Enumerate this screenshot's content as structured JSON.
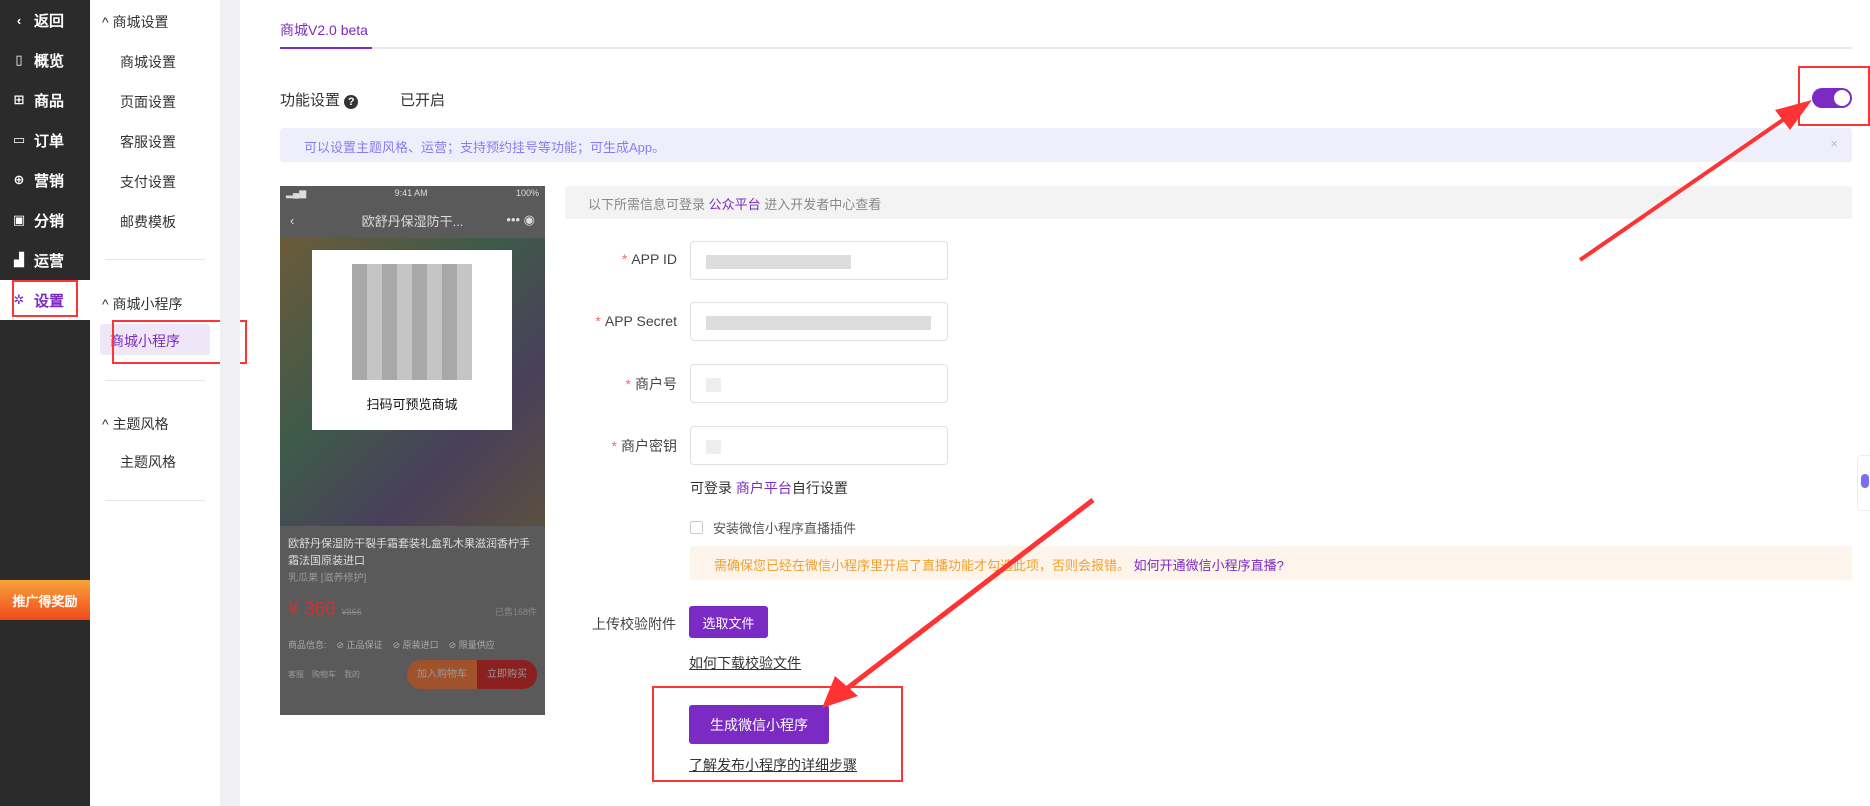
{
  "nav": {
    "items": [
      {
        "label": "返回",
        "icon": "chevron-left-icon"
      },
      {
        "label": "概览",
        "icon": "book-icon"
      },
      {
        "label": "商品",
        "icon": "gift-icon"
      },
      {
        "label": "订单",
        "icon": "folder-icon"
      },
      {
        "label": "营销",
        "icon": "target-icon"
      },
      {
        "label": "分销",
        "icon": "wallet-icon"
      },
      {
        "label": "运营",
        "icon": "bar-chart-icon"
      },
      {
        "label": "设置",
        "icon": "gear-icon"
      }
    ],
    "active": "设置",
    "promo": "推广得奖励"
  },
  "submenu": {
    "groups": [
      {
        "title": "商城设置",
        "items": [
          "商城设置",
          "页面设置",
          "客服设置",
          "支付设置",
          "邮费模板"
        ]
      },
      {
        "title": "商城小程序",
        "items": [
          "商城小程序"
        ]
      },
      {
        "title": "主题风格",
        "items": [
          "主题风格"
        ]
      }
    ]
  },
  "main": {
    "tab": "商城V2.0 beta",
    "feature_label": "功能设置",
    "feature_status": "已开启",
    "toggle_on": true,
    "banner": "可以设置主题风格、运营；支持预约挂号等功能；可生成App。",
    "info_prefix": "以下所需信息可登录 ",
    "info_link": "公众平台",
    "info_suffix": " 进入开发者中心查看",
    "fields": [
      {
        "label": "APP ID"
      },
      {
        "label": "APP Secret"
      },
      {
        "label": "商户号"
      },
      {
        "label": "商户密钥"
      }
    ],
    "merchant_prefix": "可登录 ",
    "merchant_link": "商户平台",
    "merchant_suffix": "自行设置",
    "live_plugin": "安装微信小程序直播插件",
    "notice": "需确保您已经在微信小程序里开启了直播功能才勾选此项，否则会报错。",
    "notice_link": "如何开通微信小程序直播?",
    "upload_label": "上传校验附件",
    "choose_file": "选取文件",
    "download_help": "如何下载校验文件",
    "generate": "生成微信小程序",
    "publish_help": "了解发布小程序的详细步骤"
  },
  "phone": {
    "time": "9:41 AM",
    "battery": "100%",
    "title": "欧舒丹保湿防干...",
    "qr_caption": "扫码可预览商城",
    "product": "欧舒丹保湿防干裂手霜套装礼盒乳木果滋润香柠手霜法国原装进口",
    "variant": "乳瓜果 [滋养修护]",
    "price": "¥ 360",
    "old_price": "¥866",
    "sold": "已售168件",
    "info_label": "商品信息:",
    "tags": [
      "正品保证",
      "原装进口",
      "限量供应"
    ],
    "bottom": [
      "客服",
      "购物车",
      "我的"
    ],
    "cart": "加入购物车",
    "buy": "立即购买"
  },
  "colors": {
    "accent": "#7b2bc4",
    "annotation": "#ff3333"
  }
}
